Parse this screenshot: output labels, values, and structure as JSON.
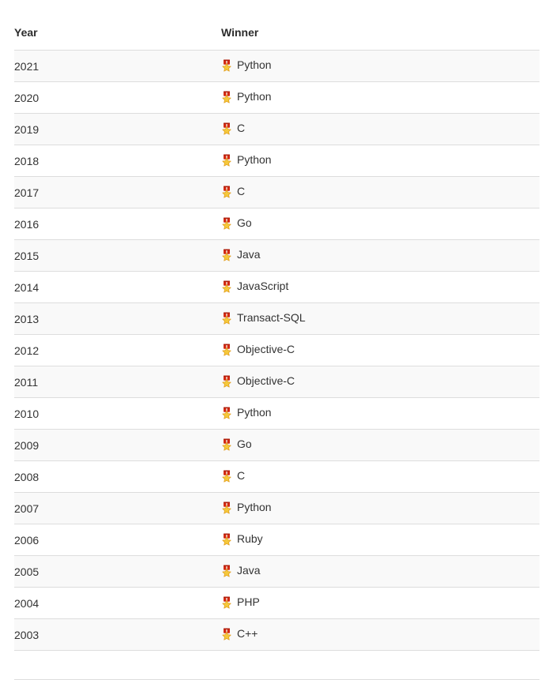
{
  "table": {
    "columns": [
      {
        "key": "year",
        "label": "Year"
      },
      {
        "key": "winner",
        "label": "Winner"
      }
    ],
    "icon": {
      "name": "medal-icon",
      "glyph": "🎖",
      "ribbon_color": "#d32a12",
      "star_color": "#f5c83b",
      "star_outline": "#e09a1a"
    },
    "colors": {
      "text": "#333333",
      "header_text": "#2b2b2b",
      "row_stripe": "#f9f9f9",
      "row_plain": "#ffffff",
      "border": "#dddddd",
      "page_background": "#ffffff"
    },
    "rows": [
      {
        "year": "2021",
        "winner": "Python"
      },
      {
        "year": "2020",
        "winner": "Python"
      },
      {
        "year": "2019",
        "winner": "C"
      },
      {
        "year": "2018",
        "winner": "Python"
      },
      {
        "year": "2017",
        "winner": "C"
      },
      {
        "year": "2016",
        "winner": "Go"
      },
      {
        "year": "2015",
        "winner": "Java"
      },
      {
        "year": "2014",
        "winner": "JavaScript"
      },
      {
        "year": "2013",
        "winner": "Transact-SQL"
      },
      {
        "year": "2012",
        "winner": "Objective-C"
      },
      {
        "year": "2011",
        "winner": "Objective-C"
      },
      {
        "year": "2010",
        "winner": "Python"
      },
      {
        "year": "2009",
        "winner": "Go"
      },
      {
        "year": "2008",
        "winner": "C"
      },
      {
        "year": "2007",
        "winner": "Python"
      },
      {
        "year": "2006",
        "winner": "Ruby"
      },
      {
        "year": "2005",
        "winner": "Java"
      },
      {
        "year": "2004",
        "winner": "PHP"
      },
      {
        "year": "2003",
        "winner": "C++"
      },
      {
        "year": "",
        "winner": ""
      }
    ]
  }
}
